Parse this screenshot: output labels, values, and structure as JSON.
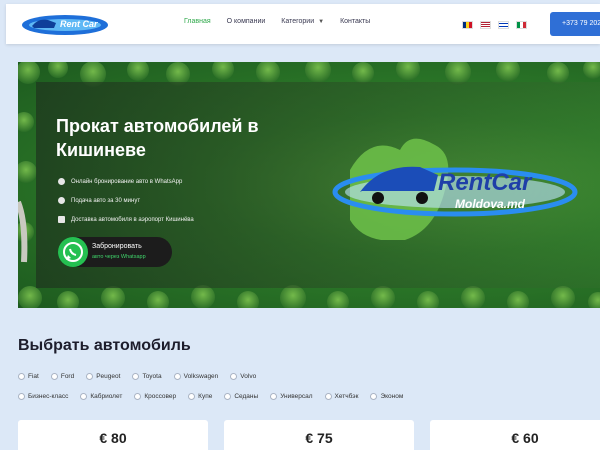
{
  "header": {
    "logo_text": "Rent Car",
    "nav": [
      "Главная",
      "О компании",
      "Категории",
      "Контакты"
    ],
    "phone": "+373 79 2020"
  },
  "hero": {
    "title": "Прокат автомобилей в Кишиневе",
    "features": [
      "Онлайн бронирование авто в WhatsApp",
      "Подача авто за 30 минут",
      "Доставка автомобиля в аэропорт Кишинёва"
    ],
    "whatsapp_title": "Забронировать",
    "whatsapp_sub": "авто через Whatsapp",
    "logo_line1": "RentCar",
    "logo_line2": "Moldova.md"
  },
  "section": {
    "title": "Выбрать автомобиль",
    "brands": [
      "Fiat",
      "Ford",
      "Peugeot",
      "Toyota",
      "Volkswagen",
      "Volvo"
    ],
    "classes": [
      "Бизнес-класс",
      "Кабриолет",
      "Кроссовер",
      "Купе",
      "Седаны",
      "Универсал",
      "Хетчбэк",
      "Эконом"
    ]
  },
  "cards": [
    {
      "price": "€ 80"
    },
    {
      "price": "€ 75"
    },
    {
      "price": "€ 60"
    }
  ],
  "colors": {
    "accent_green": "#2ea84a",
    "phone_blue": "#2f6fd6",
    "background": "#dce8f7"
  }
}
